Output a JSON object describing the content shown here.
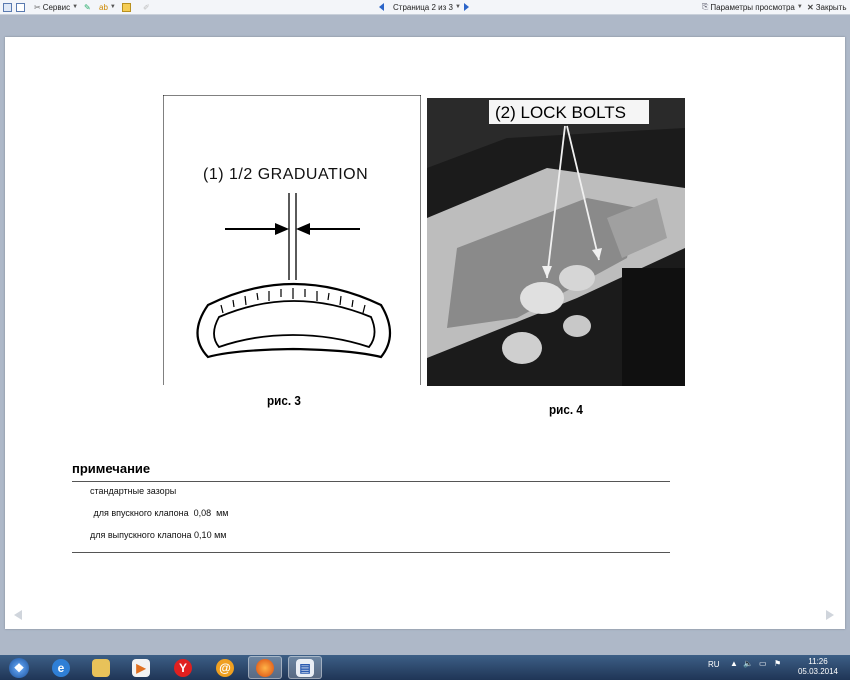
{
  "toolbar": {
    "service_label": "Сервис",
    "page_indicator": "Страница 2 из 3",
    "view_params_label": "Параметры просмотра",
    "close_label": "Закрыть"
  },
  "document": {
    "fig3_label": "(1) 1/2 GRADUATION",
    "fig3_caption": "рис. 3",
    "fig4_label": "(2) LOCK BOLTS",
    "fig4_caption": "рис. 4",
    "note_title": "примечание",
    "note_lines": [
      "стандартные зазоры",
      " для впускного клапона  0,08  мм",
      "для выпускного клапона 0,10 мм"
    ]
  },
  "taskbar": {
    "language": "RU",
    "time": "11:26",
    "date": "05.03.2014"
  }
}
